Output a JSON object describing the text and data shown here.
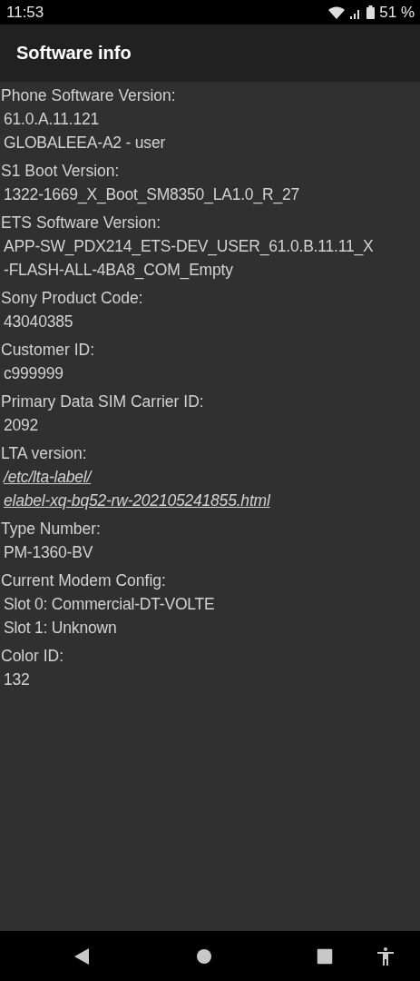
{
  "status_bar": {
    "time": "11:53",
    "battery": "51 %"
  },
  "app_bar": {
    "title": "Software info"
  },
  "sections": [
    {
      "label": "Phone Software Version:",
      "values": [
        {
          "kind": "text",
          "text": "61.0.A.11.121"
        },
        {
          "kind": "text",
          "text": "GLOBALEEA-A2 - user"
        }
      ]
    },
    {
      "label": "S1 Boot Version:",
      "values": [
        {
          "kind": "text",
          "text": "1322-1669_X_Boot_SM8350_LA1.0_R_27"
        }
      ]
    },
    {
      "label": "ETS Software Version:",
      "values": [
        {
          "kind": "text",
          "text": "APP-SW_PDX214_ETS-DEV_USER_61.0.B.11.11_X"
        },
        {
          "kind": "text",
          "text": "-FLASH-ALL-4BA8_COM_Empty"
        }
      ]
    },
    {
      "label": "Sony Product Code:",
      "values": [
        {
          "kind": "text",
          "text": "43040385"
        }
      ]
    },
    {
      "label": "Customer ID:",
      "values": [
        {
          "kind": "text",
          "text": "c999999"
        }
      ]
    },
    {
      "label": "Primary Data SIM Carrier ID:",
      "values": [
        {
          "kind": "text",
          "text": "2092"
        }
      ]
    },
    {
      "label": "LTA version:",
      "values": [
        {
          "kind": "link",
          "text": "/etc/lta-label/"
        },
        {
          "kind": "link",
          "text": "elabel-xq-bq52-rw-202105241855.html"
        }
      ]
    },
    {
      "label": "Type Number:",
      "values": [
        {
          "kind": "text",
          "text": "PM-1360-BV"
        }
      ]
    },
    {
      "label": "Current Modem Config:",
      "values": [
        {
          "kind": "text",
          "text": "Slot 0: Commercial-DT-VOLTE"
        },
        {
          "kind": "text",
          "text": "Slot 1: Unknown"
        }
      ]
    },
    {
      "label": "Color ID:",
      "values": [
        {
          "kind": "text",
          "text": "132"
        }
      ]
    }
  ]
}
